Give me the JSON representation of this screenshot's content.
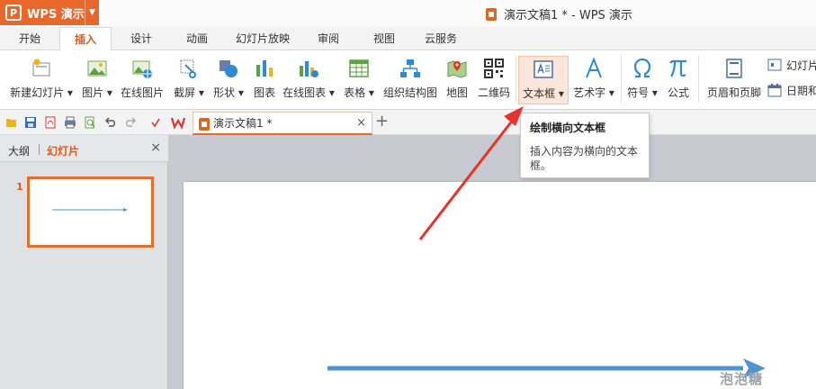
{
  "app": {
    "name": "WPS 演示",
    "logo_letter": "P",
    "split_arrow": "▼"
  },
  "window": {
    "title": "演示文稿1 * - WPS 演示"
  },
  "tabs": [
    {
      "label": "开始"
    },
    {
      "label": "插入",
      "active": true
    },
    {
      "label": "设计"
    },
    {
      "label": "动画"
    },
    {
      "label": "幻灯片放映"
    },
    {
      "label": "审阅"
    },
    {
      "label": "视图"
    },
    {
      "label": "云服务"
    }
  ],
  "ribbon": {
    "new_slide": "新建幻灯片 ▾",
    "picture": "图片 ▾",
    "online_picture": "在线图片",
    "screenshot": "截屏 ▾",
    "shape": "形状 ▾",
    "chart": "图表",
    "online_chart": "在线图表 ▾",
    "table": "表格 ▾",
    "org_chart": "组织结构图",
    "map": "地图",
    "qr_code": "二维码",
    "textbox": "文本框 ▾",
    "wordart": "艺术字 ▾",
    "symbol": "符号 ▾",
    "formula": "公式",
    "header_footer": "页眉和页脚",
    "slide_number": "幻灯片",
    "date_time": "日期和"
  },
  "document_tab": {
    "label": "演示文稿1 *",
    "close": "×",
    "add": "+"
  },
  "panel": {
    "outline_tab": "大纲",
    "slides_tab": "幻灯片",
    "close": "×",
    "slide_number": "1"
  },
  "tooltip": {
    "title": "绘制横向文本框",
    "description": "插入内容为横向的文本框。"
  },
  "watermark": "泡泡糖 ppt.cn",
  "colors": {
    "accent": "#e8682c",
    "arrow_red": "#e8332a",
    "arrow_blue": "#4f93cf"
  }
}
